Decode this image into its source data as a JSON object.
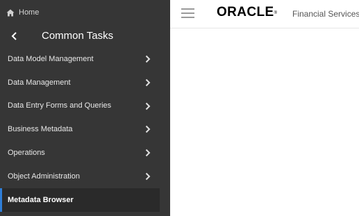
{
  "sidebar": {
    "home": {
      "label": "Home",
      "icon": "home-icon"
    },
    "header": {
      "title": "Common Tasks",
      "back_icon": "chevron-left-icon"
    },
    "items": [
      {
        "label": "Data Model Management",
        "icon": "chevron-right-icon"
      },
      {
        "label": "Data Management",
        "icon": "chevron-right-icon"
      },
      {
        "label": "Data Entry Forms and Queries",
        "icon": "chevron-right-icon"
      },
      {
        "label": "Business Metadata",
        "icon": "chevron-right-icon"
      },
      {
        "label": "Operations",
        "icon": "chevron-right-icon"
      },
      {
        "label": "Object Administration",
        "icon": "chevron-right-icon"
      },
      {
        "label": "Metadata Browser",
        "active": true
      }
    ]
  },
  "topbar": {
    "menu_icon": "hamburger-icon",
    "brand": "ORACLE",
    "brand_mark": "®",
    "product": "Financial Services"
  },
  "colors": {
    "sidebar_bg": "#363636",
    "active_indicator": "#2f7ed8",
    "topbar_bg": "#ffffff"
  }
}
